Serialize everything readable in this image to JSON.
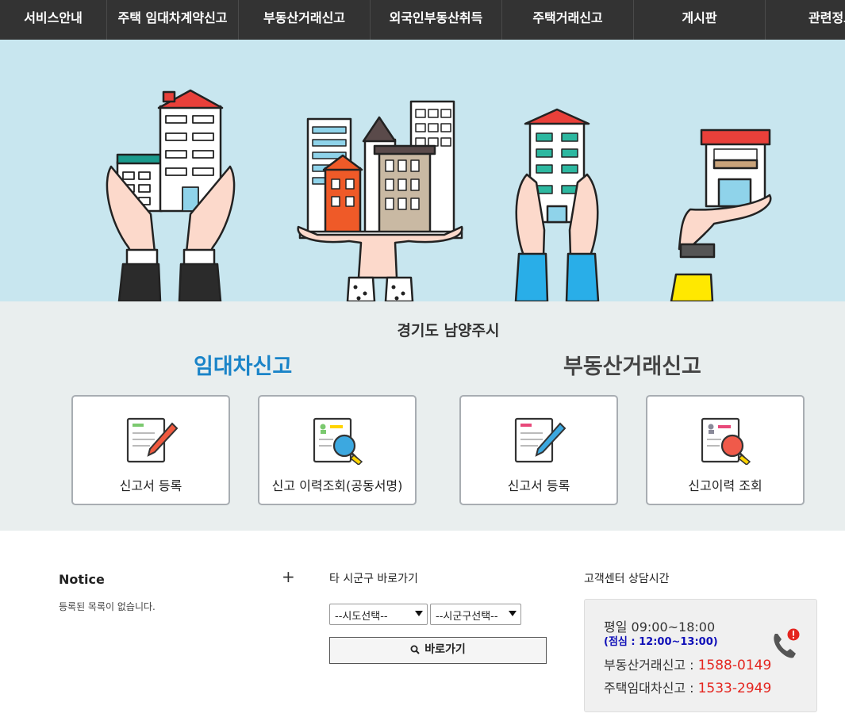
{
  "nav": {
    "items": [
      {
        "label": "서비스안내",
        "w": 0
      },
      {
        "label": "주택 임대차계약신고"
      },
      {
        "label": "부동산거래신고"
      },
      {
        "label": "외국인부동산취득"
      },
      {
        "label": "주택거래신고"
      },
      {
        "label": "게시판"
      },
      {
        "label": "관련정보"
      }
    ]
  },
  "report": {
    "region": "경기도 남양주시",
    "lease": {
      "title": "임대차신고",
      "cards": [
        {
          "label": "신고서 등록",
          "icon": "pencil-form-icon"
        },
        {
          "label": "신고 이력조회(공동서명)",
          "icon": "magnifier-form-icon"
        }
      ]
    },
    "deal": {
      "title": "부동산거래신고",
      "cards": [
        {
          "label": "신고서 등록",
          "icon": "pencil-form-icon"
        },
        {
          "label": "신고이력 조회",
          "icon": "magnifier-form-icon"
        }
      ]
    }
  },
  "notice": {
    "title": "Notice",
    "more": "+",
    "empty": "등록된 목록이 없습니다."
  },
  "goto": {
    "title": "타 시군구 바로가기",
    "sido_selected": "--시도선택--",
    "sigungu_selected": "--시군구선택--",
    "button": "바로가기"
  },
  "cs": {
    "title": "고객센터 상담시간",
    "hours": "평일 09:00~18:00",
    "lunch": "(점심 : 12:00~13:00)",
    "deal_label": "부동산거래신고 : ",
    "deal_phone": "1588-0149",
    "lease_label": "주택임대차신고 : ",
    "lease_phone": "1533-2949"
  },
  "colors": {
    "nav_bg": "#333333",
    "hero_bg": "#c8e6ef",
    "lease_title": "#1a84c8",
    "phone_red": "#e4251f",
    "lunch_blue": "#1010b8"
  }
}
